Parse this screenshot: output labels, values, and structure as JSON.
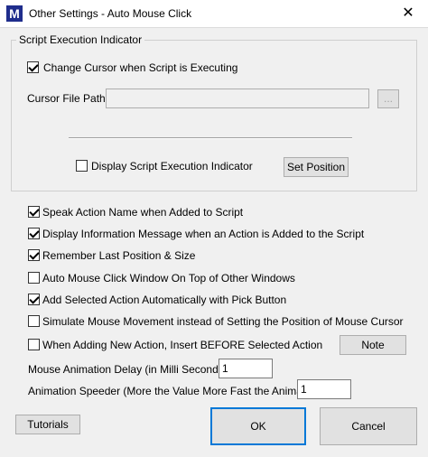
{
  "window": {
    "title": "Other Settings - Auto Mouse Click",
    "icon_letter": "M",
    "close_glyph": "✕"
  },
  "script_indicator": {
    "legend": "Script Execution Indicator",
    "change_cursor": {
      "label": "Change Cursor when Script is Executing",
      "checked": true
    },
    "cursor_path_label": "Cursor File Path :",
    "cursor_path_value": "",
    "browse_label": "...",
    "display_indicator": {
      "label": "Display Script Execution Indicator",
      "checked": false
    },
    "set_position_label": "Set Position"
  },
  "options": [
    {
      "label": "Speak Action Name when Added to Script",
      "checked": true
    },
    {
      "label": "Display Information Message when an Action is Added to the Script",
      "checked": true
    },
    {
      "label": "Remember Last Position & Size",
      "checked": true
    },
    {
      "label": "Auto Mouse Click Window On Top of Other Windows",
      "checked": false
    },
    {
      "label": "Add Selected Action Automatically with Pick Button",
      "checked": true
    },
    {
      "label": "Simulate Mouse Movement instead of Setting the Position of Mouse Cursor",
      "checked": false
    },
    {
      "label": "When Adding New Action, Insert BEFORE Selected Action",
      "checked": false
    }
  ],
  "note_label": "Note",
  "animation_delay": {
    "label": "Mouse Animation Delay (in Milli Second(s)) :",
    "value": "1"
  },
  "animation_speeder": {
    "label": "Animation Speeder (More the Value More Fast the Animation) :",
    "value": "1"
  },
  "footer": {
    "tutorials_label": "Tutorials",
    "ok_label": "OK",
    "cancel_label": "Cancel"
  }
}
